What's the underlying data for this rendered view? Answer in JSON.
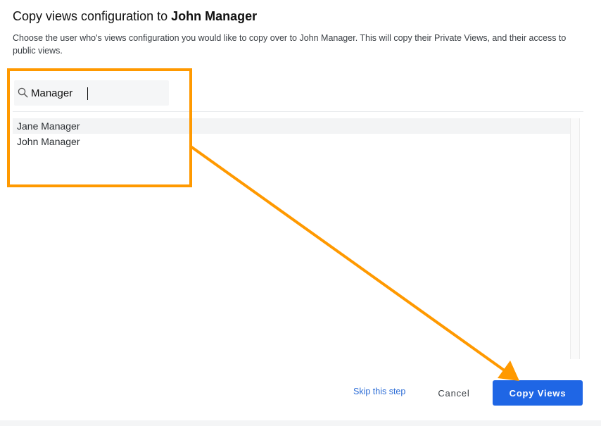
{
  "dialog": {
    "title_prefix": "Copy views configuration to ",
    "title_user": "John Manager",
    "description": "Choose the user who's views configuration you would like to copy over to John Manager. This will copy their Private Views, and their access to public views."
  },
  "search": {
    "value": "Manager",
    "icon": "search-icon"
  },
  "users": [
    {
      "name": "Jane Manager"
    },
    {
      "name": "John Manager"
    }
  ],
  "actions": {
    "skip_label": "Skip this step",
    "cancel_label": "Cancel",
    "copy_label": "Copy Views"
  },
  "colors": {
    "primary": "#1f66e5",
    "link": "#2b6cd6",
    "annotation": "#ff9900"
  }
}
